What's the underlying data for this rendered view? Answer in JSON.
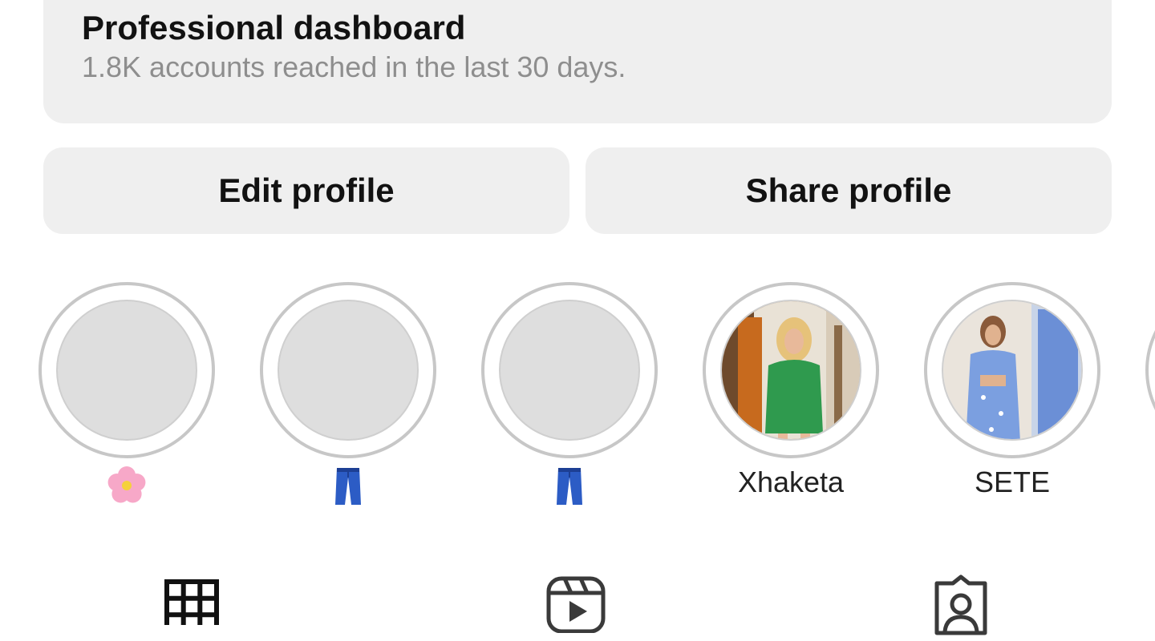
{
  "dashboard": {
    "title": "Professional dashboard",
    "subtitle": "1.8K accounts reached in the last 30 days."
  },
  "buttons": {
    "edit_profile": "Edit profile",
    "share_profile": "Share profile"
  },
  "highlights": [
    {
      "label": "🌸",
      "icon": "cherry-blossom-icon"
    },
    {
      "label": "👖",
      "icon": "jeans-icon"
    },
    {
      "label": "👖",
      "icon": "jeans-icon"
    },
    {
      "label": "Xhaketa",
      "icon": "story-thumbnail"
    },
    {
      "label": "SETE",
      "icon": "story-thumbnail"
    }
  ],
  "tabs": [
    {
      "icon": "grid-icon",
      "selected": true
    },
    {
      "icon": "reels-icon",
      "selected": false
    },
    {
      "icon": "tagged-icon",
      "selected": false
    }
  ],
  "colors": {
    "panel_bg": "#efefef",
    "ring": "#c7c7c7",
    "placeholder": "#dedede",
    "muted_text": "#8e8e8e"
  }
}
